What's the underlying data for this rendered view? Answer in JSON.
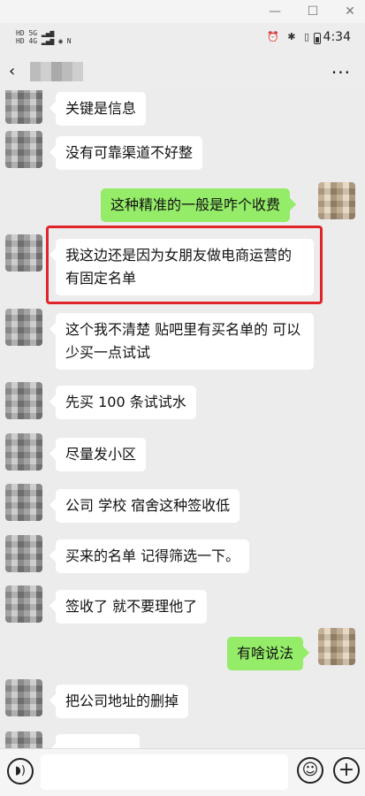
{
  "window": {
    "minimize": "—",
    "maximize": "☐",
    "close": "✕"
  },
  "status": {
    "sig_left": "HD 5G\nHD 4G",
    "icons": "⏰ ✱ ▯",
    "time": "4:34"
  },
  "nav": {
    "back_icon": "‹",
    "more_icon": "···"
  },
  "messages": [
    {
      "side": "in",
      "text": "关键是信息"
    },
    {
      "side": "in",
      "text": "没有可靠渠道不好整"
    },
    {
      "side": "out",
      "text": "这种精准的一般是咋个收费"
    },
    {
      "side": "in",
      "text": "我这边还是因为女朋友做电商运营的 有固定名单"
    },
    {
      "side": "in",
      "text": "这个我不清楚 贴吧里有买名单的 可以少买一点试试"
    },
    {
      "side": "in",
      "text": "先买 100 条试试水"
    },
    {
      "side": "in",
      "text": "尽量发小区"
    },
    {
      "side": "in",
      "text": "公司 学校 宿舍这种签收低"
    },
    {
      "side": "in",
      "text": "买来的名单 记得筛选一下。"
    },
    {
      "side": "in",
      "text": "签收了 就不要理他了"
    },
    {
      "side": "out",
      "text": "有啥说法"
    },
    {
      "side": "in",
      "text": "把公司地址的删掉"
    },
    {
      "side": "in",
      "text": ""
    }
  ],
  "input": {
    "voice_icon": "◗)",
    "emoji_icon": "☺",
    "plus_icon": "+",
    "placeholder": ""
  }
}
